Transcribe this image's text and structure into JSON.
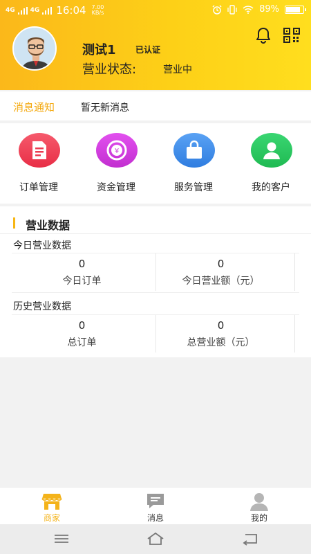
{
  "status_bar": {
    "signal1": "4G",
    "signal2": "4G",
    "time": "16:04",
    "speed_value": "7.00",
    "speed_unit": "KB/s",
    "battery": "89%",
    "battery_level": 0.89
  },
  "profile": {
    "name": "测试1",
    "verified": "已认证",
    "status_label": "营业状态:",
    "status_value": "营业中"
  },
  "notice": {
    "title": "消息通知",
    "text": "暂无新消息"
  },
  "menu": [
    {
      "label": "订单管理",
      "icon": "document-icon",
      "color": "#ee3b52"
    },
    {
      "label": "资金管理",
      "icon": "coin-icon",
      "color": "#c93bd6"
    },
    {
      "label": "服务管理",
      "icon": "bag-icon",
      "color": "#3c89e8"
    },
    {
      "label": "我的客户",
      "icon": "person-icon",
      "color": "#27c45e"
    }
  ],
  "business": {
    "title": "营业数据",
    "today_title": "今日营业数据",
    "today": [
      {
        "value": "0",
        "label": "今日订单"
      },
      {
        "value": "0",
        "label": "今日营业额（元）"
      }
    ],
    "history_title": "历史营业数据",
    "history": [
      {
        "value": "0",
        "label": "总订单"
      },
      {
        "value": "0",
        "label": "总营业额（元）"
      }
    ]
  },
  "tabs": [
    {
      "label": "商家",
      "icon": "shop-icon",
      "active": true
    },
    {
      "label": "消息",
      "icon": "message-icon",
      "active": false
    },
    {
      "label": "我的",
      "icon": "user-icon",
      "active": false
    }
  ],
  "colors": {
    "accent": "#f7b614",
    "tab_active": "#f4b31a",
    "tab_inactive": "#9a9a9a"
  }
}
